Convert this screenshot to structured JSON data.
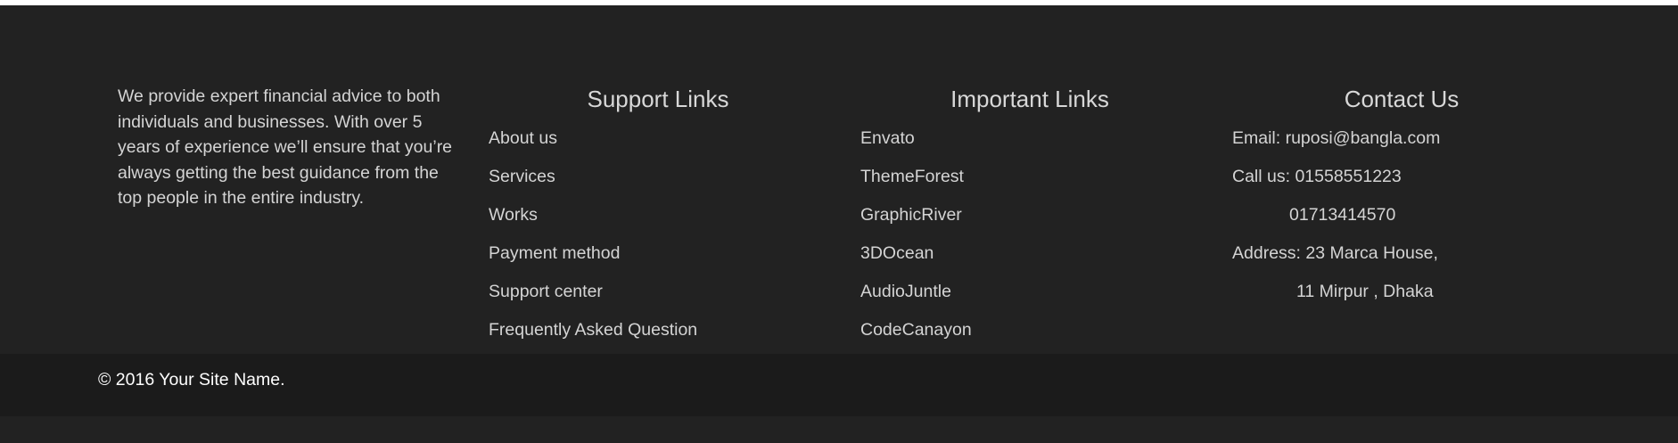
{
  "about": {
    "text": "We provide expert financial advice to both individuals and businesses. With over 5 years of experience we’ll ensure that you’re always getting the best guidance from the top people in the entire industry."
  },
  "support": {
    "heading": "Support Links",
    "links": [
      "About us",
      "Services",
      "Works",
      "Payment method",
      "Support center",
      "Frequently Asked Question"
    ]
  },
  "important": {
    "heading": "Important Links",
    "links": [
      "Envato",
      "ThemeForest",
      "GraphicRiver",
      "3DOcean",
      "AudioJuntle",
      "CodeCanayon"
    ]
  },
  "contact": {
    "heading": "Contact Us",
    "email": "Email: ruposi@bangla.com",
    "phone1": "Call us: 01558551223",
    "phone2": "01713414570",
    "address1": "Address: 23 Marca House,",
    "address2": "11 Mirpur , Dhaka"
  },
  "copyright": "© 2016 Your Site Name.",
  "colors": {
    "footer_bg": "#222222",
    "bottom_bar_bg": "#1b1b1b",
    "text": "#d4d4d4"
  }
}
